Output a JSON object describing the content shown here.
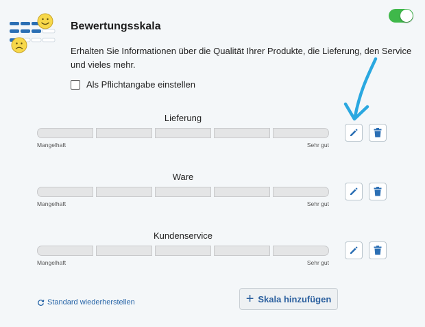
{
  "header": {
    "title": "Bewertungsskala",
    "description": "Erhalten Sie Informationen über die Qualität Ihrer Produkte, die Lieferung, den Service und vieles mehr.",
    "enabled": true,
    "toggle_icon": "toggle-switch-on",
    "colors": {
      "toggle_on": "#3fb84a",
      "icon_blue": "#2b6fb4",
      "smiley_yellow": "#f7d84a",
      "arrow": "#2aa8e0"
    }
  },
  "mandatory": {
    "label": "Als Pflichtangabe einstellen",
    "checked": false
  },
  "scales": [
    {
      "title": "Lieferung",
      "low_label": "Mangelhaft",
      "high_label": "Sehr gut",
      "steps": 5
    },
    {
      "title": "Ware",
      "low_label": "Mangelhaft",
      "high_label": "Sehr gut",
      "steps": 5
    },
    {
      "title": "Kundenservice",
      "low_label": "Mangelhaft",
      "high_label": "Sehr gut",
      "steps": 5
    }
  ],
  "actions": {
    "restore_label": "Standard wiederherstellen",
    "add_label": "Skala hinzufügen",
    "edit_icon": "pencil-icon",
    "delete_icon": "trash-icon"
  }
}
